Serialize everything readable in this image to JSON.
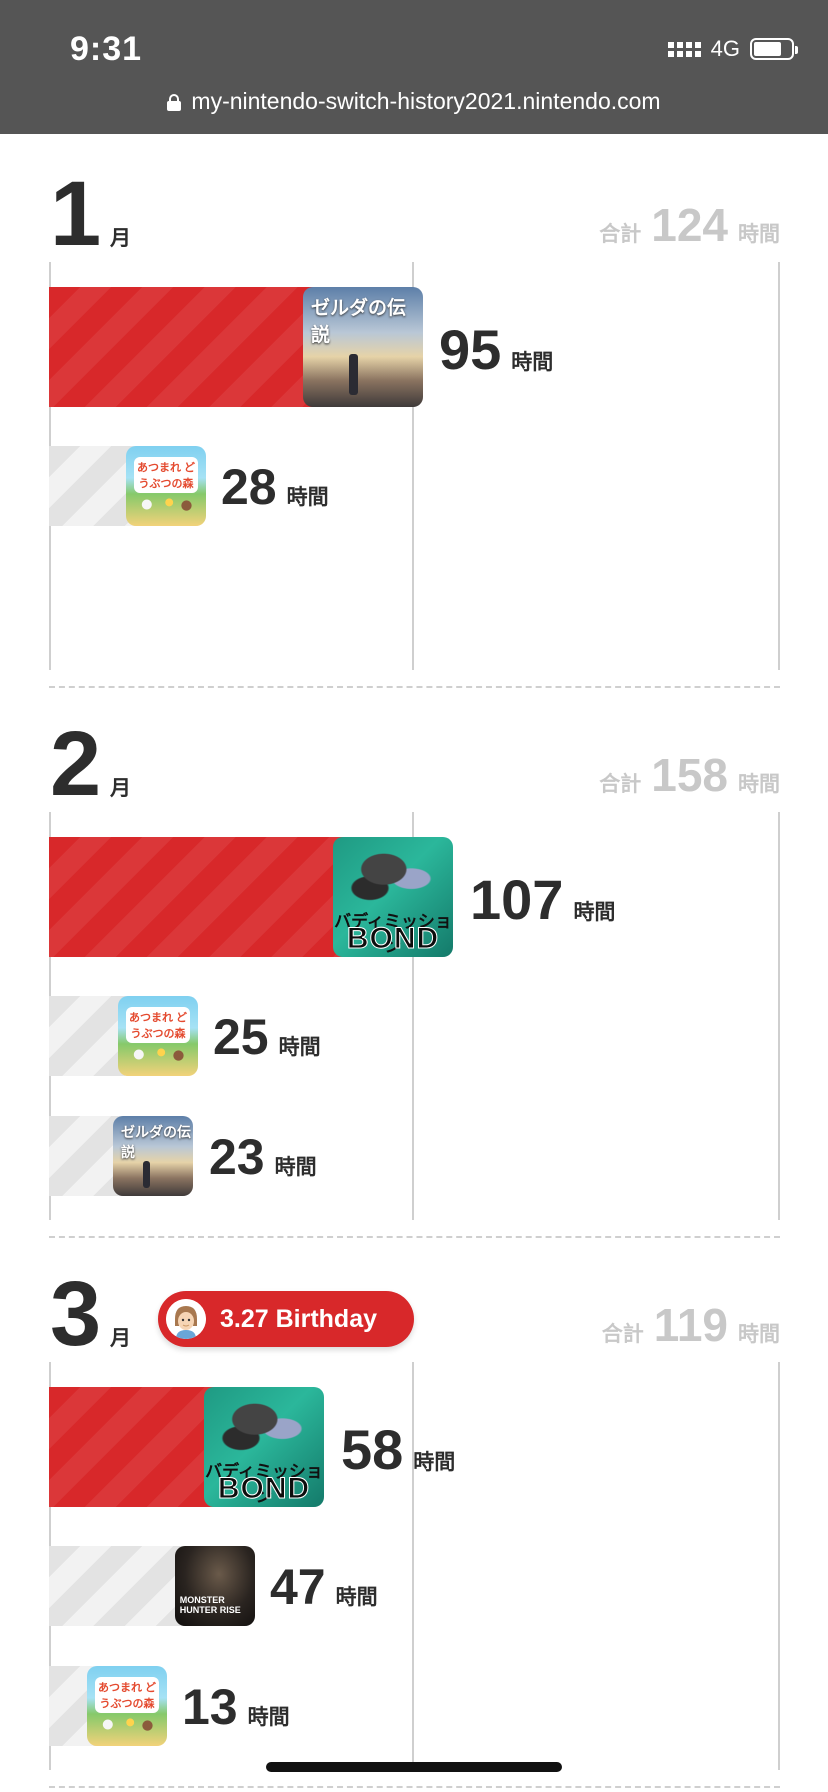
{
  "status_bar": {
    "time": "9:31",
    "network": "4G",
    "url": "my-nintendo-switch-history2021.nintendo.com"
  },
  "labels": {
    "month_unit": "月",
    "total_label": "合計",
    "hours_unit": "時間"
  },
  "months": [
    {
      "month": "1",
      "total": "124",
      "games": [
        {
          "hours": "95",
          "title_art": "ゼルダの伝説",
          "icon": "zelda-botw-cover",
          "rank": "top"
        },
        {
          "hours": "28",
          "title_art": "あつまれ どうぶつの森",
          "icon": "animal-crossing-cover",
          "rank": "other"
        }
      ]
    },
    {
      "month": "2",
      "total": "158",
      "games": [
        {
          "hours": "107",
          "title_art_1": "バディミッション",
          "title_art_2": "BOND",
          "icon": "buddy-mission-bond-cover",
          "rank": "top"
        },
        {
          "hours": "25",
          "title_art": "あつまれ どうぶつの森",
          "icon": "animal-crossing-cover",
          "rank": "other"
        },
        {
          "hours": "23",
          "title_art": "ゼルダの伝説",
          "icon": "zelda-botw-cover",
          "rank": "other"
        }
      ]
    },
    {
      "month": "3",
      "total": "119",
      "birthday": "3.27 Birthday",
      "games": [
        {
          "hours": "58",
          "title_art_1": "バディミッション",
          "title_art_2": "BOND",
          "icon": "buddy-mission-bond-cover",
          "rank": "top"
        },
        {
          "hours": "47",
          "title_art": "MONSTER HUNTER RISE",
          "icon": "monster-hunter-rise-cover",
          "rank": "other"
        },
        {
          "hours": "13",
          "title_art": "あつまれ どうぶつの森",
          "icon": "animal-crossing-cover",
          "rank": "other"
        }
      ]
    }
  ],
  "colors": {
    "top_bar": "#d8282a",
    "other_bar": "#e3e3e3",
    "total_text": "#c8c8c8",
    "status_bg": "#555555"
  }
}
